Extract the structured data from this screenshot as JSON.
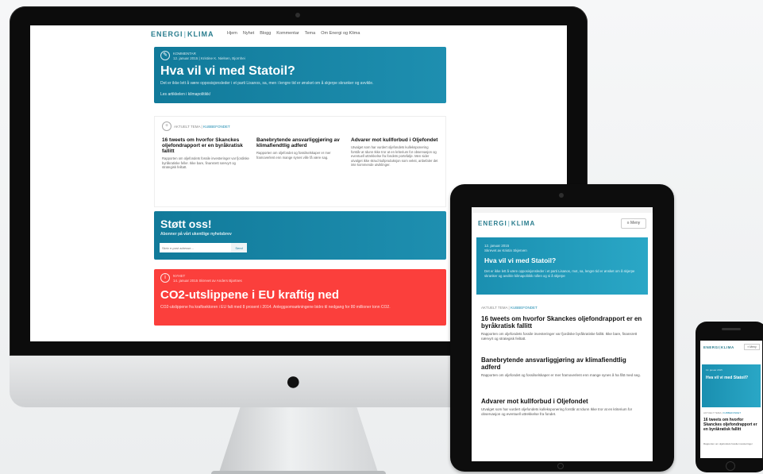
{
  "site": {
    "logo_left": "ENERGI",
    "logo_sep": "|",
    "logo_right": "KLIMA"
  },
  "desktop": {
    "nav": [
      "Hjem",
      "Nyhet",
      "Blogg",
      "Kommentar",
      "Tema",
      "Om Energi og Klima"
    ],
    "feature": {
      "icon": "chat-icon",
      "meta_line1": "KOMMENTAR",
      "meta_line2": "12. januar 2015 | Kristine K. Nielsen, Bjornhei",
      "title": "Hva vil vi med Statoil?",
      "text": "Det er ikke lett å være opposisjonsleder i et parti Lisanos, sa, men i lengre tid er ønsket om å skjerpe skranker og avvikle.",
      "link": "Les artikkelen i kilmapolitikk/"
    },
    "articles": {
      "label": "AKTUELT TEMA",
      "label_link": "KUBBEFONDET",
      "items": [
        {
          "title": "16 tweets om hvorfor Skanckes oljefondrapport er en byråkratisk fallitt",
          "text": "Rapporten om oljefondets fossile investeringer var fjordiske byråkratiske feller. Ikke bare, finansrett nærvyrt og strategisk feiltatt."
        },
        {
          "title": "Banebrytende ansvarliggjøring av klimafiendtlig adferd",
          "text": "Rapporten om oljefondet og fossilselskaper er mer framoverlent enn mange synes ville få være sag."
        },
        {
          "title": "Advarer mot kullforbud i Oljefondet",
          "text": "Utvalget som har vurdert oljefondets kulleksponering forstår at Idunn Ikke tror at en kriterium for observasjon og eventuell uttrekkelse fra fondets portefølje. Men sider utvalget ikke skrud kullproduksjon som vekst, anbefaler det inte kommende utviklinger."
        }
      ]
    },
    "donate": {
      "title": "Støtt oss!",
      "subtitle": "Abonner på vårt ukentlige nyhetsbrev",
      "placeholder": "Skriv e-post adresse...",
      "button": "Send"
    },
    "news": {
      "icon": "info-icon",
      "meta_line1": "NYHET",
      "meta_line2": "14. januar 2015 Skrevet av Anders Bjartnes",
      "title": "CO2-utslippene i EU kraftig ned",
      "text": "CO2-utslippene fra kraftsektoren i EU falt med 8 prosent i 2014. Anleggsomsøkningene bidro til nedgang for 80 millioner tonn CO2."
    }
  },
  "tablet": {
    "status": "",
    "menu": "≡ Meny",
    "feature": {
      "meta_line1": "12. januar 2015",
      "meta_line2": "Skrevet av Kristin Skjerven",
      "title": "Hva vil vi med Statoil?",
      "text": "Det er ikke lett å være opposisjonsleder i et parti Lisanos, mot, sa, lengre tid er ønsket om å skjerpe skranker og avvikle kilmapolitikk rollen og si å skjerpe"
    },
    "label": "AKTUELT TEMA",
    "label_link": "KUBBEFONDET",
    "articles": [
      {
        "title": "16 tweets om hvorfor Skanckes oljefondrapport er en byråkratisk fallitt",
        "text": "Rapporten om oljefondets fossile investeringer var fjordiske byråkratiske fallitt. Ikke bare, finansrett nærvyrt og strategisk feiltatt."
      },
      {
        "title": "Banebrytende ansvarliggjøring av klimafiendtlig adferd",
        "text": "Rapporten om oljefondet og fossilselskaper er mer framoverlent enn mange synes å ha fått med seg."
      },
      {
        "title": "Advarer mot kullforbud i Oljefondet",
        "text": "Utvalget som har vurdert oljefondets kulleksponering forstår at Idunn Ikke tror at en kriterium for observasjon og eventuell uttrekkelse fra fondet."
      }
    ]
  },
  "phone": {
    "menu": "≡ Meny",
    "feature": {
      "meta": "12. januar 2015",
      "title": "Hva vil vi med Statoil?"
    },
    "label": "AKTUELT TEMA",
    "label_link": "KUBBEFONDET",
    "article_title": "16 tweets om hvorfor Skanckes oljefondrapport er en byråkratisk fallitt",
    "article_text": "Rapporten om oljefondets fossile investeringer"
  },
  "colors": {
    "brand_teal": "#2a7d8e",
    "card_blue": "#117a9a",
    "card_red": "#fb3f3c"
  }
}
